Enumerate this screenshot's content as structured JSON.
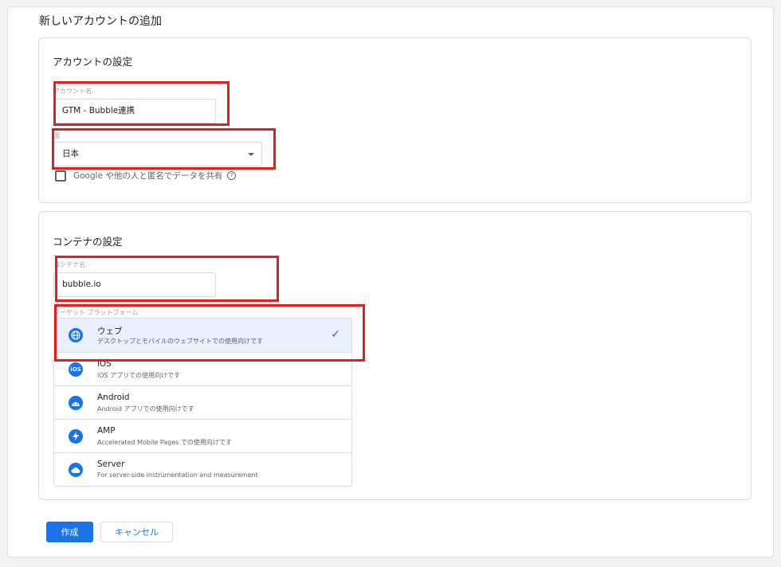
{
  "page": {
    "title": "新しいアカウントの追加"
  },
  "account_settings": {
    "title": "アカウントの設定",
    "account_name_label": "アカウント名",
    "account_name_value": "GTM - Bubble連携",
    "country_label": "国",
    "country_value": "日本",
    "share_checkbox_label": "Google や他の人と匿名でデータを共有",
    "share_checked": false
  },
  "container_settings": {
    "title": "コンテナの設定",
    "container_name_label": "コンテナ名",
    "container_name_value": "bubble.io",
    "platform_label": "ターゲット プラットフォーム",
    "platforms": [
      {
        "name": "ウェブ",
        "desc": "デスクトップとモバイルのウェブサイトでの使用向けです",
        "icon": "globe-icon",
        "selected": true
      },
      {
        "name": "iOS",
        "desc": "iOS アプリでの使用向けです",
        "icon": "ios-icon",
        "selected": false
      },
      {
        "name": "Android",
        "desc": "Android アプリでの使用向けです",
        "icon": "android-icon",
        "selected": false
      },
      {
        "name": "AMP",
        "desc": "Accelerated Mobile Pages での使用向けです",
        "icon": "lightning-icon",
        "selected": false
      },
      {
        "name": "Server",
        "desc": "For server-side instrumentation and measurement",
        "icon": "cloud-icon",
        "selected": false
      }
    ]
  },
  "actions": {
    "create_label": "作成",
    "cancel_label": "キャンセル"
  },
  "colors": {
    "accent": "#1a73e8",
    "highlight_box": "#e0201f",
    "selected_bg": "#e8f0fe"
  }
}
